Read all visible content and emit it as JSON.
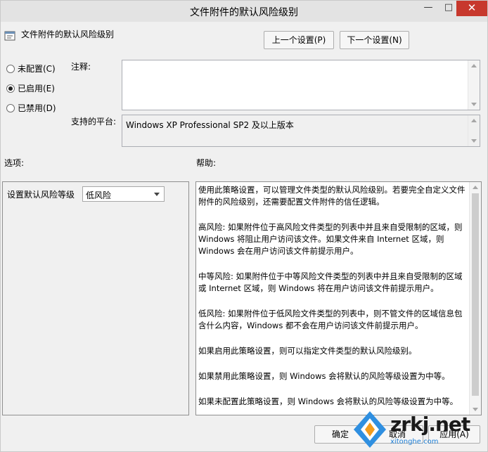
{
  "window": {
    "title": "文件附件的默认风险级别",
    "minimize_glyph": "—",
    "maximize_glyph": "□",
    "close_glyph": "✕"
  },
  "header": {
    "policy_title": "文件附件的默认风险级别",
    "prev_button": "上一个设置(P)",
    "next_button": "下一个设置(N)",
    "icon": "policy-settings-icon"
  },
  "state": {
    "options": [
      {
        "label": "未配置(C)",
        "selected": false
      },
      {
        "label": "已启用(E)",
        "selected": true
      },
      {
        "label": "已禁用(D)",
        "selected": false
      }
    ]
  },
  "comment": {
    "label": "注释:",
    "value": ""
  },
  "platform": {
    "label": "支持的平台:",
    "value": "Windows XP Professional SP2 及以上版本"
  },
  "options_panel": {
    "header": "选项:",
    "setting_label": "设置默认风险等级",
    "selected_value": "低风险"
  },
  "help_panel": {
    "header": "帮助:",
    "paragraphs": [
      "使用此策略设置，可以管理文件类型的默认风险级别。若要完全自定义文件附件的风险级别，还需要配置文件附件的信任逻辑。",
      "高风险: 如果附件位于高风险文件类型的列表中并且来自受限制的区域，则 Windows 将阻止用户访问该文件。如果文件来自 Internet 区域，则 Windows 会在用户访问该文件前提示用户。",
      "中等风险: 如果附件位于中等风险文件类型的列表中并且来自受限制的区域或 Internet 区域，则 Windows 将在用户访问该文件前提示用户。",
      "低风险: 如果附件位于低风险文件类型的列表中，则不管文件的区域信息包含什么内容，Windows 都不会在用户访问该文件前提示用户。",
      "如果启用此策略设置，则可以指定文件类型的默认风险级别。",
      "如果禁用此策略设置，则 Windows 会将默认的风险等级设置为中等。",
      "如果未配置此策略设置，则 Windows 会将默认的风险等级设置为中等。"
    ]
  },
  "footer": {
    "ok_button": "确定",
    "cancel_button": "取消",
    "apply_button": "应用(A)"
  },
  "watermark": {
    "brand": "zrkj.net",
    "sub": "xitonghe.com"
  },
  "colors": {
    "close_button": "#c7382d",
    "window_bg": "#f0f0f0",
    "watermark_blue": "#1e7fd6"
  }
}
